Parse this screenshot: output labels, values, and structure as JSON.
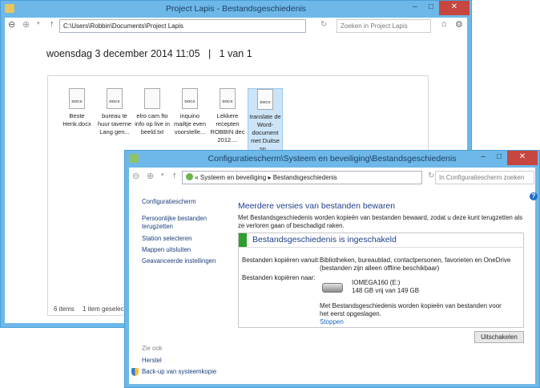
{
  "explorer": {
    "title": "Project Lapis - Bestandsgeschiedenis",
    "address": "C:\\Users\\Robbin\\Documents\\Project Lapis",
    "search_placeholder": "Zoeken in Project Lapis",
    "heading": "woensdag 3 december 2014 11:05   |   1 van 1",
    "files": [
      {
        "name": "Beste Henk.docx",
        "type": "DOCX"
      },
      {
        "name": "bureau te huur taverne Lang gen...",
        "type": "DOCX"
      },
      {
        "name": "elro cam fto info op live in beeld.txt",
        "type": ""
      },
      {
        "name": "inquino mailtje even voorstelle...",
        "type": "DOCX"
      },
      {
        "name": "Lekkere recepten ROBBIN dec 2012....",
        "type": "DOCX"
      },
      {
        "name": "translate de Word-document met Duitse sp...",
        "type": "DOCX",
        "selected": true
      }
    ],
    "status_count": "6 items",
    "status_selected": "1 item geselecteerd"
  },
  "control": {
    "title": "Configuratiescherm\\Systeem en beveiliging\\Bestandsgeschiedenis",
    "breadcrumb_prefix": "«",
    "crumb1": "Systeem en beveiliging",
    "crumb2": "Bestandsgeschiedenis",
    "search_placeholder": "In Configuratiescherm zoeken",
    "nav": {
      "home": "Configuratiescherm",
      "restore": "Persoonlijke bestanden terugzetten",
      "drive": "Station selecteren",
      "exclude": "Mappen uitsluiten",
      "advanced": "Geavanceerde instellingen"
    },
    "see_also": "Zie ook",
    "recovery": "Herstel",
    "backup": "Back-up van systeemkopie",
    "heading": "Meerdere versies van bestanden bewaren",
    "description": "Met Bestandsgeschiedenis worden kopieën van bestanden bewaard, zodat u deze kunt terugzetten als ze verloren gaan of beschadigd raken.",
    "status": "Bestandsgeschiedenis is ingeschakeld",
    "status_color": "#2e9e2e",
    "copy_from_label": "Bestanden kopiëren vanuit:",
    "copy_from_value": "Bibliotheken, bureaublad, contactpersonen, favorieten en OneDrive (bestanden zijn alleen offline beschikbaar)",
    "copy_to_label": "Bestanden kopiëren naar:",
    "drive_name": "IOMEGA160 (E:)",
    "drive_space": "148 GB vrij van 149 GB",
    "info": "Met Bestandsgeschiedenis worden kopieën van bestanden voor het eerst opgeslagen.",
    "stop": "Stoppen",
    "disable": "Uitschakelen"
  }
}
